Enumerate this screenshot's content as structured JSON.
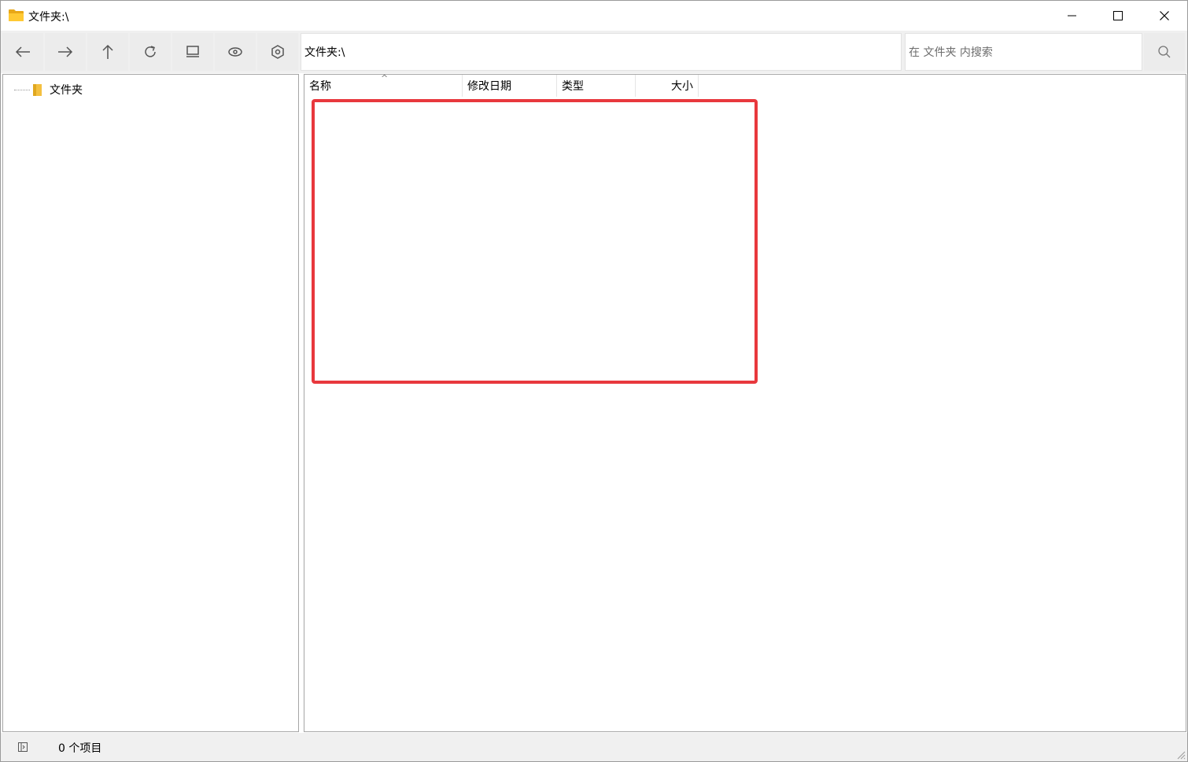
{
  "window": {
    "title": "文件夹:\\",
    "icon": "folder-icon",
    "controls": [
      "minimize-icon",
      "maximize-icon",
      "close-icon"
    ]
  },
  "toolbar": {
    "buttons": [
      {
        "icon": "back-arrow-icon"
      },
      {
        "icon": "forward-arrow-icon"
      },
      {
        "icon": "up-arrow-icon"
      },
      {
        "icon": "refresh-icon"
      },
      {
        "icon": "view-icon"
      },
      {
        "icon": "preview-eye-icon"
      },
      {
        "icon": "settings-icon"
      }
    ],
    "address": "文件夹:\\",
    "search_placeholder": "在 文件夹 内搜索",
    "search_icon": "search-icon"
  },
  "tree": {
    "items": [
      {
        "label": "文件夹",
        "icon": "folder-icon"
      }
    ]
  },
  "list": {
    "columns": {
      "name": "名称",
      "date": "修改日期",
      "type": "类型",
      "size": "大小"
    },
    "sort_indicator": "^",
    "rows": []
  },
  "statusbar": {
    "toggle_icon": "pane-toggle-icon",
    "count_text": "0 个项目"
  },
  "colors": {
    "highlight": "#e8383d",
    "toolbar_bg": "#f0f0f0",
    "folder_yellow": "#f4c040"
  }
}
